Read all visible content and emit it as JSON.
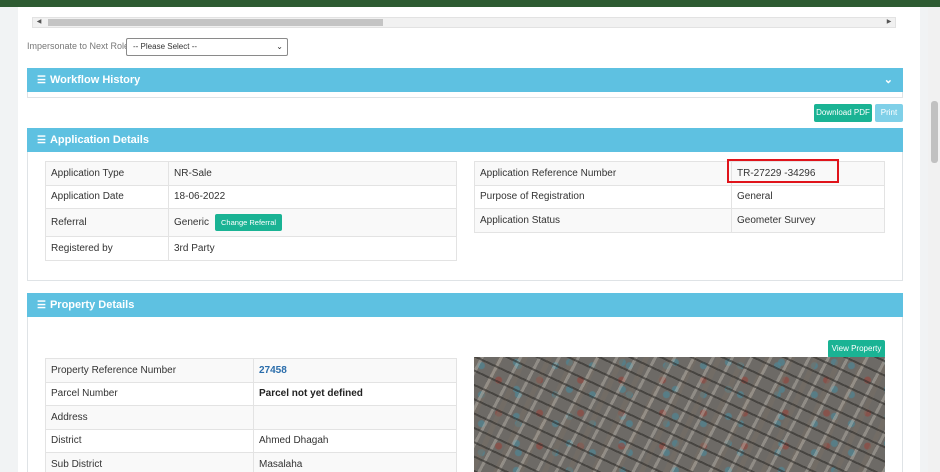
{
  "impersonate": {
    "label": "Impersonate to Next Role",
    "selected": "-- Please Select --"
  },
  "workflow": {
    "title": "Workflow History"
  },
  "actions": {
    "download_pdf": "Download PDF",
    "print": "Print"
  },
  "application": {
    "title": "Application Details",
    "left": [
      {
        "label": "Application Type",
        "value": "NR-Sale"
      },
      {
        "label": "Application Date",
        "value": "18-06-2022"
      },
      {
        "label": "Referral",
        "value": "Generic",
        "button": "Change Referral"
      },
      {
        "label": "Registered by",
        "value": "3rd Party"
      }
    ],
    "right": [
      {
        "label": "Application Reference Number",
        "value": "TR-27229 -34296"
      },
      {
        "label": "Purpose of Registration",
        "value": "General"
      },
      {
        "label": "Application Status",
        "value": "Geometer Survey"
      }
    ]
  },
  "property": {
    "title": "Property Details",
    "view_button": "View Property",
    "rows": [
      {
        "label": "Property Reference Number",
        "value": "27458"
      },
      {
        "label": "Parcel Number",
        "value": "Parcel not yet defined"
      },
      {
        "label": "Address",
        "value": ""
      },
      {
        "label": "District",
        "value": "Ahmed Dhagah"
      },
      {
        "label": "Sub District",
        "value": "Masalaha"
      }
    ]
  },
  "colors": {
    "header": "#5ec1e1",
    "accent_green": "#1ab394",
    "highlight": "#e0141b"
  }
}
